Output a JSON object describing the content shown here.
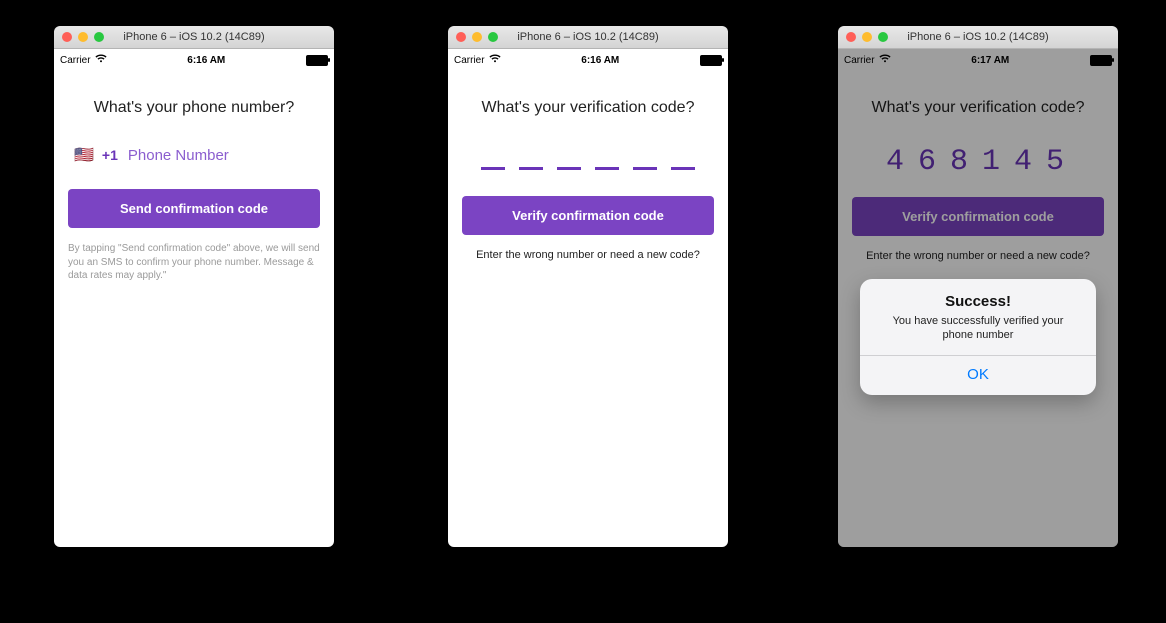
{
  "colors": {
    "accent": "#7b44c3",
    "accent_text": "#6a34b8",
    "ios_blue": "#007aff"
  },
  "sim1": {
    "window_title": "iPhone 6 – iOS 10.2 (14C89)",
    "status": {
      "carrier": "Carrier",
      "time": "6:16 AM"
    },
    "heading": "What's your phone number?",
    "flag_emoji": "🇺🇸",
    "dial_code": "+1",
    "phone_placeholder": "Phone Number",
    "button_label": "Send confirmation code",
    "disclaimer": "By tapping \"Send confirmation code\" above, we will send you an SMS to confirm your phone number. Message & data rates may apply.\""
  },
  "sim2": {
    "window_title": "iPhone 6 – iOS 10.2 (14C89)",
    "status": {
      "carrier": "Carrier",
      "time": "6:16 AM"
    },
    "heading": "What's your verification code?",
    "button_label": "Verify confirmation code",
    "subtext": "Enter the wrong number or need a new code?"
  },
  "sim3": {
    "window_title": "iPhone 6 – iOS 10.2 (14C89)",
    "status": {
      "carrier": "Carrier",
      "time": "6:17 AM"
    },
    "heading": "What's your verification code?",
    "code_value": "468145",
    "button_label": "Verify confirmation code",
    "subtext": "Enter the wrong number or need a new code?",
    "alert": {
      "title": "Success!",
      "message": "You have successfully verified your phone number",
      "ok_label": "OK"
    }
  }
}
